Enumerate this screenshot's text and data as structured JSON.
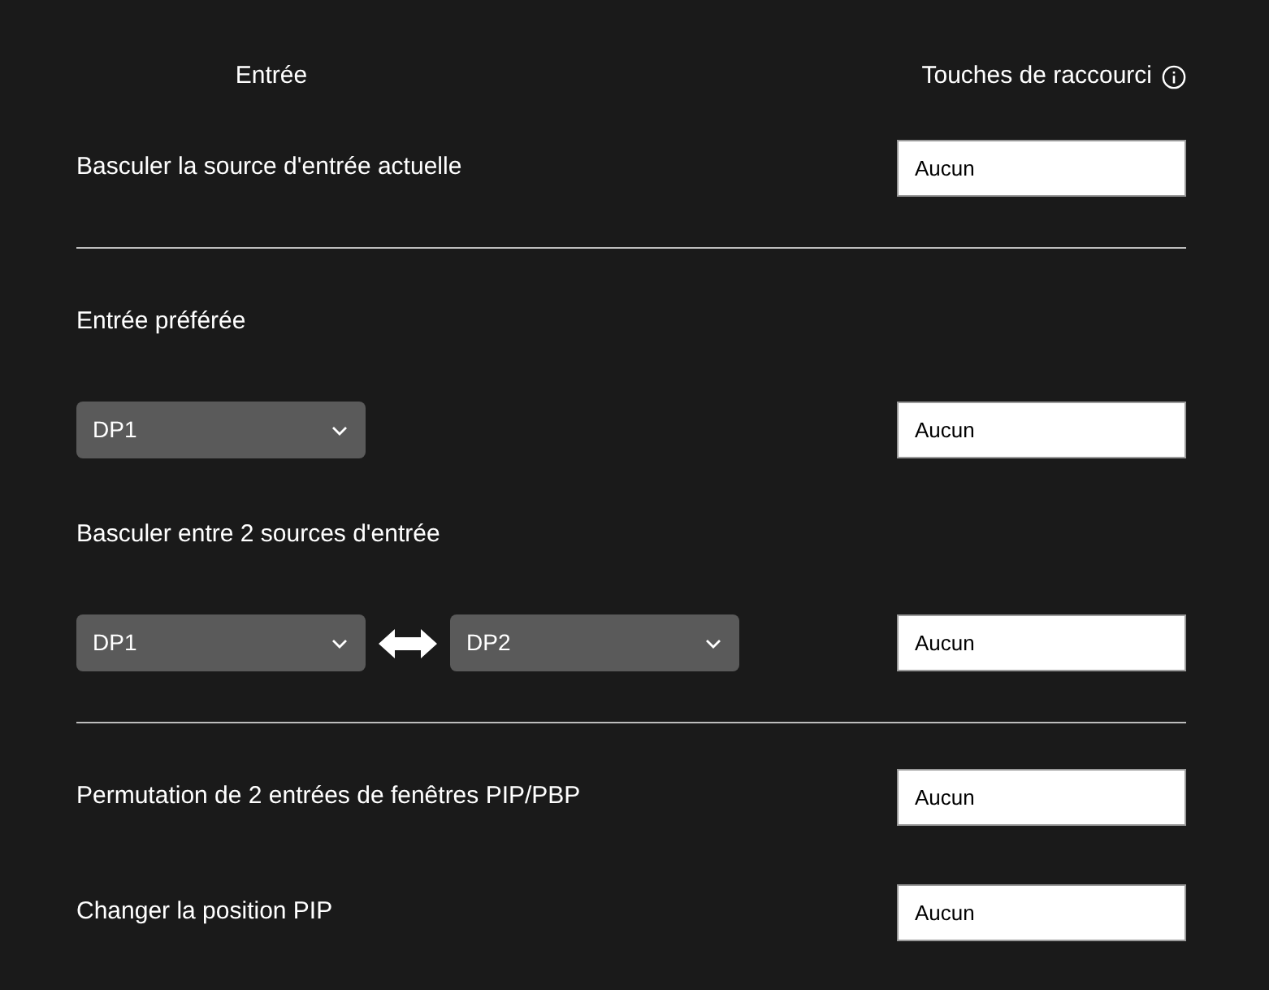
{
  "header": {
    "input_title": "Entrée",
    "shortcut_title": "Touches de raccourci"
  },
  "sections": [
    {
      "items": [
        {
          "kind": "action",
          "label": "Basculer la source d'entrée actuelle",
          "shortcut": "Aucun"
        }
      ]
    },
    {
      "items": [
        {
          "kind": "label",
          "label": "Entrée préférée"
        },
        {
          "kind": "select_row",
          "selects": [
            "DP1"
          ],
          "shortcut": "Aucun"
        },
        {
          "kind": "label",
          "label": "Basculer entre 2 sources d'entrée"
        },
        {
          "kind": "select_row",
          "selects": [
            "DP1",
            "DP2"
          ],
          "shortcut": "Aucun"
        }
      ]
    },
    {
      "items": [
        {
          "kind": "action",
          "label": "Permutation de 2 entrées de fenêtres PIP/PBP",
          "shortcut": "Aucun"
        },
        {
          "kind": "action",
          "label": "Changer la position PIP",
          "shortcut": "Aucun"
        }
      ]
    }
  ]
}
